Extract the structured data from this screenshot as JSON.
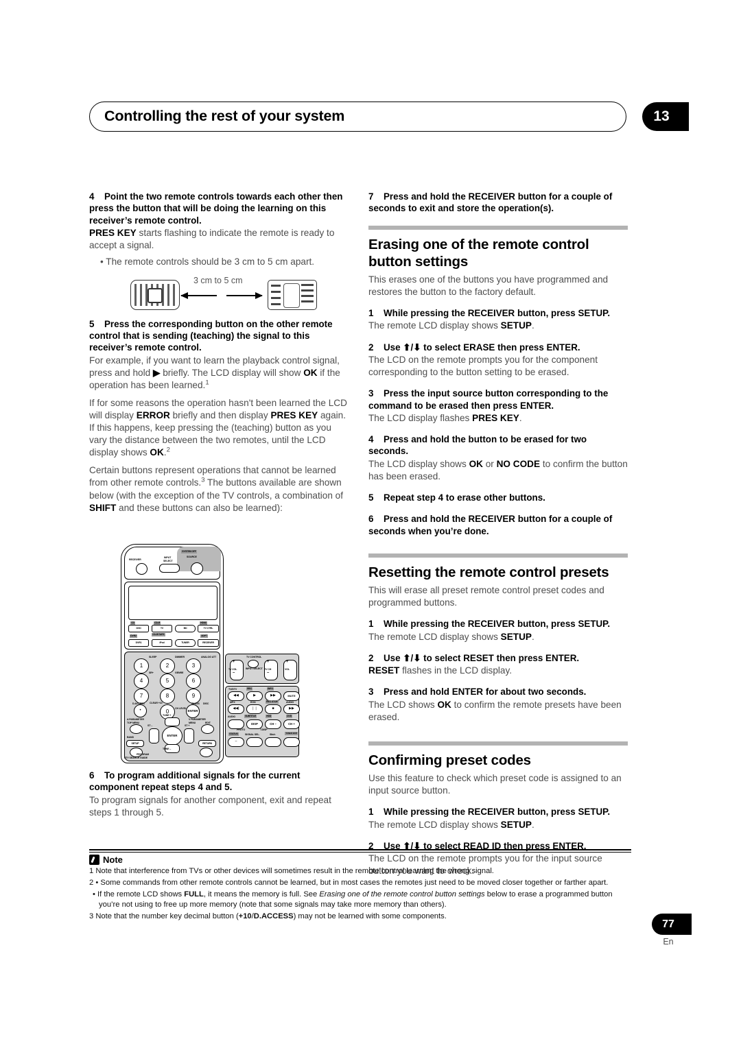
{
  "header": {
    "title": "Controlling the rest of your system",
    "chapter": "13"
  },
  "footer": {
    "page_number": "77",
    "language": "En"
  },
  "left_column": {
    "step4": {
      "num": "4",
      "heading": "Point the two remote controls towards each other then press the button that will be doing the learning on this receiver’s remote control.",
      "body_bold": "PRES KEY",
      "body_rest": " starts flashing to indicate the remote is ready to accept a signal.",
      "bullet": "• The remote controls should be 3 cm to 5 cm apart."
    },
    "distance_diagram": {
      "label": "3 cm to 5 cm",
      "left_remote": "learning-remote",
      "right_remote": "teaching-remote"
    },
    "step5": {
      "num": "5",
      "heading": "Press the corresponding button on the other remote control that is sending (teaching) the signal to this receiver’s remote control.",
      "p1_a": "For example, if you want to learn the playback control signal, press and hold ",
      "p1_play": "▶",
      "p1_b": " briefly. The LCD display will show ",
      "p1_ok": "OK",
      "p1_c": " if the operation has been learned.",
      "p1_sup": "1",
      "p2_a": "If for some reasons the operation hasn't been learned the LCD will display ",
      "p2_error": "ERROR",
      "p2_b": " briefly and then display ",
      "p2_pres": "PRES KEY",
      "p2_c": " again. If this happens, keep pressing the (teaching) button as you vary the distance between the two remotes, until the LCD display shows ",
      "p2_ok": "OK",
      "p2_d": ".",
      "p2_sup": "2",
      "p3_a": "Certain buttons represent operations that cannot be learned from other remote controls.",
      "p3_sup": "3",
      "p3_b": " The buttons available are shown below (with the exception of the TV controls, a combination of ",
      "p3_shift": "SHIFT",
      "p3_c": " and these buttons can also be learned):"
    },
    "step6": {
      "num": "6",
      "heading": "To program additional signals for the current component repeat steps 4 and 5.",
      "body": "To program signals for another component, exit and repeat steps 1 through 5."
    }
  },
  "remote_diagram": {
    "top_labels": {
      "receiver": "RECEIVER",
      "input_select_1": "INPUT",
      "input_select_2": "SELECT",
      "system_off": "SYSTEM OFF",
      "source": "SOURCE"
    },
    "source_buttons_row1_top": [
      "CD",
      "CD-R",
      "",
      "HDMI"
    ],
    "source_buttons_row1": [
      "DVD",
      "TV",
      "BD",
      "TV CTRL"
    ],
    "source_buttons_row2_top": [
      "DVR2",
      "CD-R/TAPE",
      "",
      "ADPT"
    ],
    "source_buttons_row2": [
      "DVR1",
      "iPod",
      "TUNER",
      "RECEIVER"
    ],
    "numeric_keys": [
      "1",
      "2",
      "3",
      "4",
      "5",
      "6",
      "7",
      "8",
      "9",
      "0"
    ],
    "numeric_sub_labels": [
      "SLEEP",
      "DIMMER",
      "ANALOG ATT",
      "SR+",
      "GENRE",
      "D.ACCESS",
      "CLEAR +10",
      "CLASS",
      "CH LEVEL",
      "DISC"
    ],
    "enter_label": "ENTER",
    "left_labels": [
      "A PARAMETER",
      "TOP MENU",
      "BAND",
      "SETUP",
      "PROGRAM",
      "PTY SEARCH GUIDE"
    ],
    "right_labels": [
      "V PARAMETER",
      "MENU",
      "EDIT",
      "RETURN"
    ],
    "dpad_labels": [
      "TUNE +",
      "TUNE –",
      "ST –",
      "ST +"
    ],
    "tv_control_panel": {
      "title": "TV CONTROL",
      "buttons": [
        "TV VOL",
        "INPUT SELECT",
        "TV CH",
        "VOL"
      ]
    },
    "transport_panel": {
      "row_labels_top": [
        "TV/DTV",
        "REC",
        "INFO"
      ],
      "row1": [
        "◀◀",
        "▶",
        "▶▶",
        "MUTE"
      ],
      "row1_sub": [
        "MPX",
        "EON",
        "REC STOP",
        "AUDIO"
      ],
      "row2": [
        "◀◀|",
        "❘❘",
        "■",
        "▶▶"
      ],
      "row3_top": [
        "AUDIO",
        "SUBTITLE",
        "HDD",
        "DVD"
      ],
      "row3": [
        "",
        "DISP",
        "CH –",
        "CH +"
      ],
      "row4_top": [
        "PHOTO",
        "T.DISP"
      ],
      "row4": [
        "STATUS",
        "SIGNAL SEL.",
        "Sltch",
        "TUNER EDIT"
      ]
    }
  },
  "right_column": {
    "step7": {
      "num": "7",
      "heading": "Press and hold the RECEIVER button for a couple of seconds to exit and store the operation(s)."
    },
    "section_erasing": {
      "title": "Erasing one of the remote control button settings",
      "intro": "This erases one of the buttons you have programmed and restores the button to the factory default.",
      "steps": [
        {
          "num": "1",
          "heading": "While pressing the RECEIVER button, press SETUP.",
          "body_a": "The remote LCD display shows ",
          "body_b": "SETUP",
          "body_c": "."
        },
        {
          "num": "2",
          "heading": "Use ⬆/⬇ to select ERASE then press ENTER.",
          "body_a": "The LCD on the remote prompts you for the component corresponding to the button setting to be erased.",
          "body_b": "",
          "body_c": ""
        },
        {
          "num": "3",
          "heading": "Press the input source button corresponding to the command to be erased then press ENTER.",
          "body_a": "The LCD display flashes ",
          "body_b": "PRES KEY",
          "body_c": "."
        },
        {
          "num": "4",
          "heading": "Press and hold the button to be erased for two seconds.",
          "body_a": "The LCD display shows ",
          "body_b": "OK",
          "body_c": " or ",
          "body_d": "NO CODE",
          "body_e": " to confirm the button has been erased."
        },
        {
          "num": "5",
          "heading": "Repeat step 4 to erase other buttons.",
          "body_a": "",
          "body_b": "",
          "body_c": ""
        },
        {
          "num": "6",
          "heading": "Press and hold the RECEIVER button for a couple of seconds when you’re done.",
          "body_a": "",
          "body_b": "",
          "body_c": ""
        }
      ]
    },
    "section_resetting": {
      "title": "Resetting the remote control presets",
      "intro": "This will erase all preset remote control preset codes and programmed buttons.",
      "steps": [
        {
          "num": "1",
          "heading": "While pressing the RECEIVER button, press SETUP.",
          "body_a": "The remote LCD display shows ",
          "body_b": "SETUP",
          "body_c": "."
        },
        {
          "num": "2",
          "heading": "Use ⬆/⬇ to select RESET then press ENTER.",
          "body_a": "",
          "body_b": "RESET",
          "body_c": " flashes in the LCD display."
        },
        {
          "num": "3",
          "heading": "Press and hold ENTER for about two seconds.",
          "body_a": "The LCD shows ",
          "body_b": "OK",
          "body_c": " to confirm the remote presets have been erased."
        }
      ]
    },
    "section_confirming": {
      "title": "Confirming preset codes",
      "intro": "Use this feature to check which preset code is assigned to an input source button.",
      "steps": [
        {
          "num": "1",
          "heading": "While pressing the RECEIVER button, press SETUP.",
          "body_a": "The remote LCD display shows ",
          "body_b": "SETUP",
          "body_c": "."
        },
        {
          "num": "2",
          "heading": "Use ⬆/⬇ to select READ ID then press ENTER.",
          "body_a": "The LCD on the remote prompts you for the input source button you want to check.",
          "body_b": "",
          "body_c": ""
        }
      ]
    }
  },
  "notes": {
    "title": "Note",
    "items": [
      {
        "num": "1",
        "text": "Note that interference from TVs or other devices will sometimes result in the remote control learning the wrong signal."
      },
      {
        "num": "2",
        "text": "• Some commands from other remote controls cannot be learned, but in most cases the remotes just need to be moved closer together or farther apart."
      },
      {
        "num": "",
        "prefix": "• If the remote LCD shows ",
        "bold1": "FULL",
        "mid": ", it means the memory is full. See ",
        "italic": "Erasing one of the remote control button settings",
        "suffix": " below to erase a programmed button you’re not using to free up more memory (note that some signals may take more memory than others)."
      },
      {
        "num": "3",
        "prefix": "Note that the number key decimal button (",
        "bold1": "+10",
        "mid": "/",
        "bold2": "D.ACCESS",
        "suffix": ") may not be learned with some components."
      }
    ]
  }
}
